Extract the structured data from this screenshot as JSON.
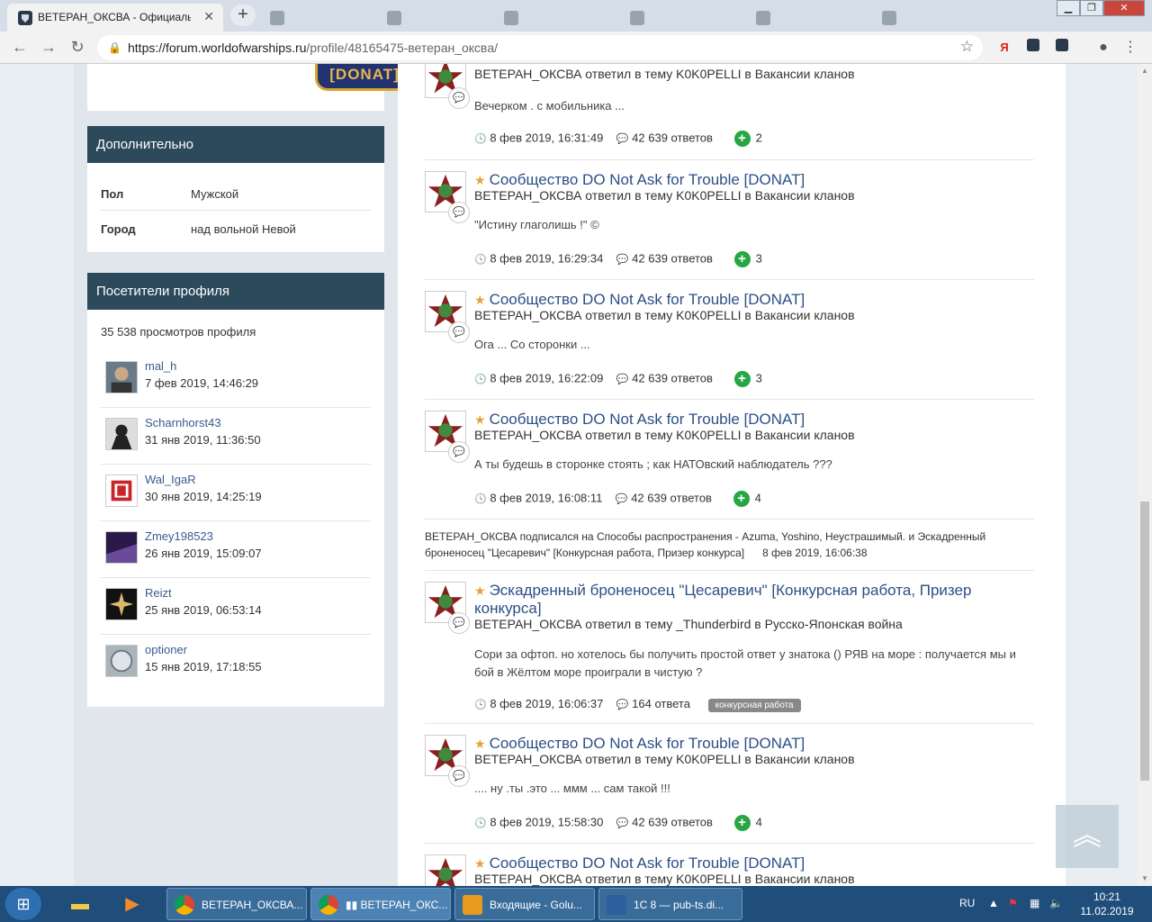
{
  "browser": {
    "active_tab_title": "ВЕТЕРАН_ОКСВА - Официаль",
    "url_host": "https://forum.worldofwarships.ru",
    "url_path": "/profile/48165475-ветерaн_окcвa/",
    "new_tab_label": "+"
  },
  "sidebar": {
    "badge_text": "[DONAT]",
    "extra": {
      "title": "Дополнительно",
      "rows": [
        {
          "key": "Пол",
          "value": "Мужской"
        },
        {
          "key": "Город",
          "value": "над вольной Невой"
        }
      ]
    },
    "visitors": {
      "title": "Посетители профиля",
      "views": "35 538 просмотров профиля",
      "list": [
        {
          "name": "mal_h",
          "date": "7 фев 2019, 14:46:29"
        },
        {
          "name": "Scharnhorst43",
          "date": "31 янв 2019, 11:36:50"
        },
        {
          "name": "Wal_IgaR",
          "date": "30 янв 2019, 14:25:19"
        },
        {
          "name": "Zmey198523",
          "date": "26 янв 2019, 15:09:07"
        },
        {
          "name": "Reizt",
          "date": "25 янв 2019, 06:53:14"
        },
        {
          "name": "optioner",
          "date": "15 янв 2019, 17:18:55"
        }
      ]
    }
  },
  "stream": {
    "items": [
      {
        "title": "",
        "sub": "ВЕТЕРАН_ОКСВА ответил в тему K0K0PELLI в Вакансии кланов",
        "body": "Вечерком . с мобильника ...",
        "date": "8 фев 2019, 16:31:49",
        "replies": "42 639 ответов",
        "likes": "2"
      },
      {
        "title": "Сообщество DO Not Ask for Trouble [DONAT]",
        "sub": "ВЕТЕРАН_ОКСВА ответил в тему K0K0PELLI в Вакансии кланов",
        "body": "\"Истину глаголишь !\" ©",
        "date": "8 фев 2019, 16:29:34",
        "replies": "42 639 ответов",
        "likes": "3"
      },
      {
        "title": "Сообщество DO Not Ask for Trouble [DONAT]",
        "sub": "ВЕТЕРАН_ОКСВА ответил в тему K0K0PELLI в Вакансии кланов",
        "body": "Ога ... Со сторонки ...",
        "date": "8 фев 2019, 16:22:09",
        "replies": "42 639 ответов",
        "likes": "3"
      },
      {
        "title": "Сообщество DO Not Ask for Trouble [DONAT]",
        "sub": "ВЕТЕРАН_ОКСВА ответил в тему K0K0PELLI в Вакансии кланов",
        "body": "А ты будешь в сторонке стоять ; как НАТОвский наблюдатель ???",
        "date": "8 фев 2019, 16:08:11",
        "replies": "42 639 ответов",
        "likes": "4"
      },
      {
        "title": "Эскадренный броненосец \"Цесаревич\" [Конкурсная работа, Призер конкурса]",
        "sub": "ВЕТЕРАН_ОКСВА ответил в тему _Thunderbird в Русско-Японская война",
        "body": "Сори за офтоп. но хотелось бы получить простой ответ у знатока () РЯВ на море : получается мы и бой в Жёлтом море проиграли в чистую ?",
        "date": "8 фев 2019, 16:06:37",
        "replies": "164 ответа",
        "tag": "конкурсная работа"
      },
      {
        "title": "Сообщество DO Not Ask for Trouble [DONAT]",
        "sub": "ВЕТЕРАН_ОКСВА ответил в тему K0K0PELLI в Вакансии кланов",
        "body": ".... ну .ты .это ... ммм ... сам такой !!!",
        "date": "8 фев 2019, 15:58:30",
        "replies": "42 639 ответов",
        "likes": "4"
      },
      {
        "title": "Сообщество DO Not Ask for Trouble [DONAT]",
        "sub": "ВЕТЕРАН_ОКСВА ответил в тему K0K0PELLI в Вакансии кланов"
      }
    ],
    "subscription_text": "ВЕТЕРАН_ОКСВА подписался на Способы распространения - Azuma, Yoshino, Неустрашимый. и Эскадренный броненосец \"Цесаревич\" [Конкурсная работа, Призер конкурса]",
    "subscription_date": "8 фев 2019, 16:06:38"
  },
  "taskbar": {
    "tasks": [
      "ВЕТЕРАН_ОКСВА...",
      "▮▮ ВЕТЕРАН_ОКС...",
      "Входящие - Golu...",
      "1С 8 — pub-ts.di..."
    ],
    "lang": "RU",
    "time": "10:21",
    "date": "11.02.2019"
  },
  "colors": {
    "card_header": "#2c4a5c",
    "link": "#2c4f86",
    "like_green": "#27a744",
    "favorite_star": "#e8a23c"
  }
}
